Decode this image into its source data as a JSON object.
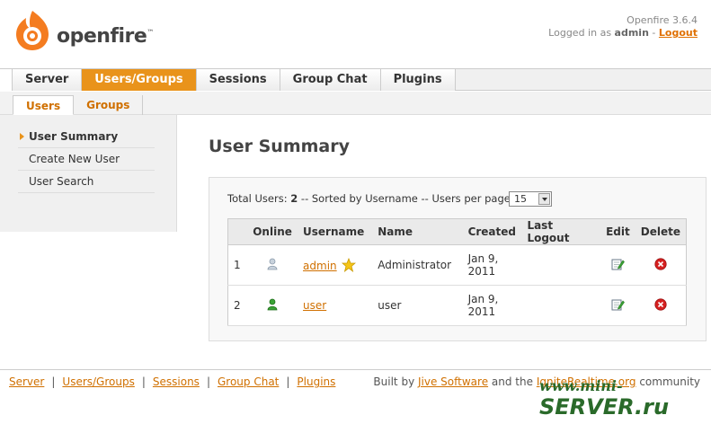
{
  "header": {
    "logo_text": "openfire",
    "logo_tm": "™",
    "version": "Openfire 3.6.4",
    "logged_in_prefix": "Logged in as",
    "username": "admin",
    "separator": "-",
    "logout_label": "Logout"
  },
  "mainnav": {
    "tabs": [
      {
        "label": "Server"
      },
      {
        "label": "Users/Groups"
      },
      {
        "label": "Sessions"
      },
      {
        "label": "Group Chat"
      },
      {
        "label": "Plugins"
      }
    ]
  },
  "subnav": {
    "tabs": [
      {
        "label": "Users"
      },
      {
        "label": "Groups"
      }
    ]
  },
  "sidebar": {
    "items": [
      {
        "label": "User Summary"
      },
      {
        "label": "Create New User"
      },
      {
        "label": "User Search"
      }
    ]
  },
  "main": {
    "title": "User Summary",
    "summary_prefix": "Total Users:",
    "total_users": "2",
    "summary_middle": "-- Sorted by Username -- Users per page:",
    "per_page": "15",
    "columns": [
      "",
      "Online",
      "Username",
      "Name",
      "Created",
      "Last Logout",
      "Edit",
      "Delete"
    ],
    "rows": [
      {
        "num": "1",
        "username": "admin",
        "name": "Administrator",
        "created": "Jan 9, 2011",
        "last_logout": "",
        "online": false,
        "is_admin": true
      },
      {
        "num": "2",
        "username": "user",
        "name": "user",
        "created": "Jan 9, 2011",
        "last_logout": "",
        "online": true,
        "is_admin": false
      }
    ]
  },
  "footer": {
    "links": [
      {
        "label": "Server"
      },
      {
        "label": "Users/Groups"
      },
      {
        "label": "Sessions"
      },
      {
        "label": "Group Chat"
      },
      {
        "label": "Plugins"
      }
    ],
    "built_by": "Built by",
    "jive": "Jive Software",
    "and_the": "and the",
    "ignite": "IgniteRealtime.org",
    "community": "community"
  },
  "watermark": {
    "prefix": "www.mini-",
    "big": "SERVER.ru"
  },
  "colors": {
    "accent": "#e9931b",
    "link": "#d07000",
    "online": "#3aa335",
    "offline": "#a0b0c0",
    "delete": "#d62020"
  }
}
